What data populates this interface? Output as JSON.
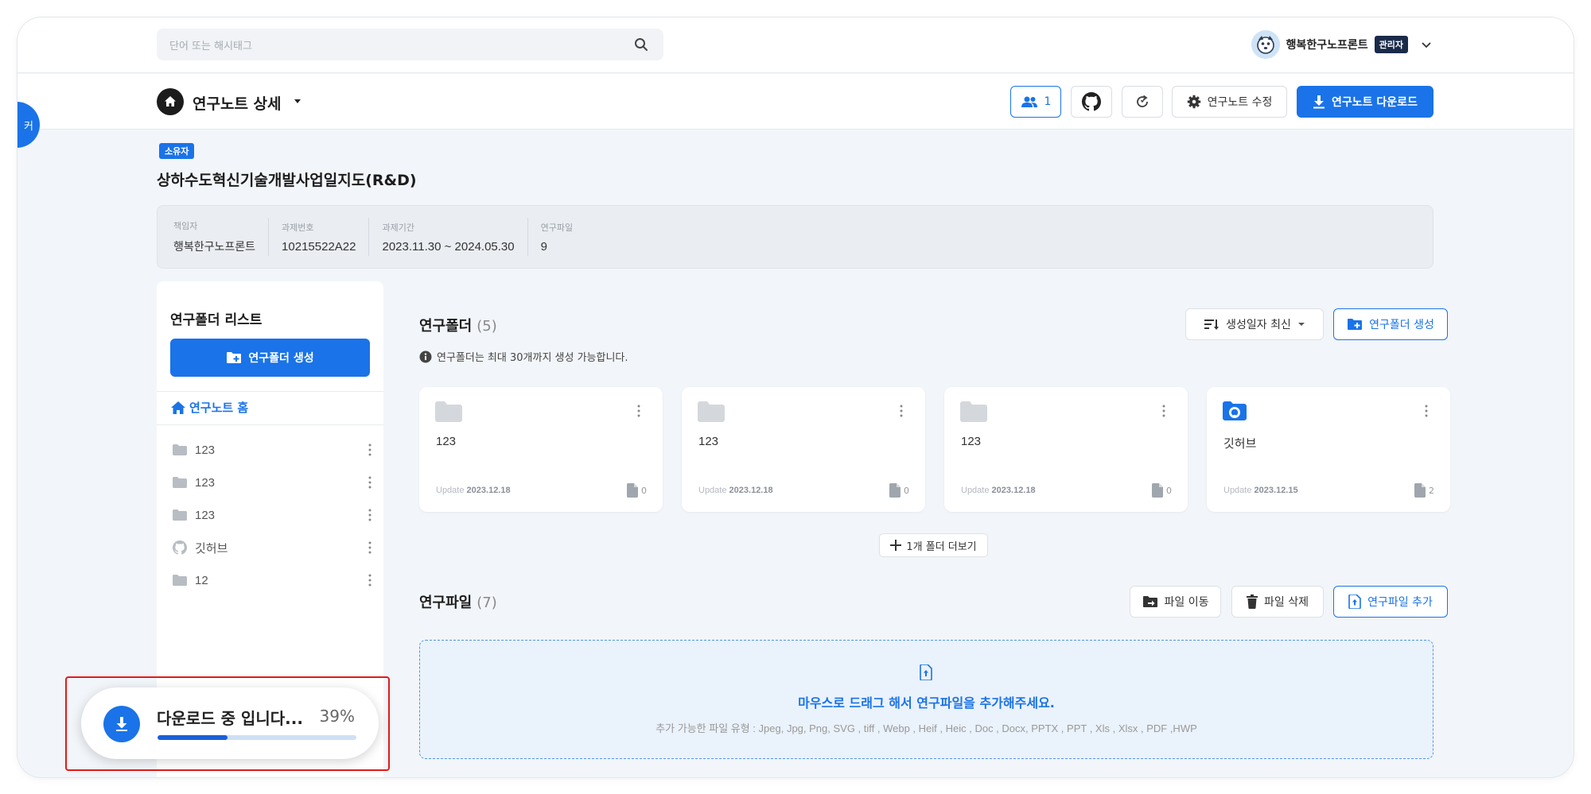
{
  "header": {
    "search_placeholder": "단어 또는 해시태그",
    "user_name": "행복한구노프론트",
    "user_role": "관리자"
  },
  "toolbar": {
    "page_title": "연구노트 상세",
    "member_count": "1",
    "edit_label": "연구노트 수정",
    "download_label": "연구노트 다운로드",
    "side_tab_label": "커"
  },
  "project": {
    "owner_badge": "소유자",
    "title": "상하수도혁신기술개발사업일지도(R&D)",
    "info": [
      {
        "label": "책임자",
        "value": "행복한구노프론트"
      },
      {
        "label": "과제번호",
        "value": "10215522A22"
      },
      {
        "label": "과제기간",
        "value": "2023.11.30 ~ 2024.05.30"
      },
      {
        "label": "연구파일",
        "value": "9"
      }
    ]
  },
  "sidebar": {
    "title": "연구폴더 리스트",
    "create_label": "연구폴더 생성",
    "home_label": "연구노트 홈",
    "items": [
      {
        "label": "123",
        "icon": "folder-icon"
      },
      {
        "label": "123",
        "icon": "folder-icon"
      },
      {
        "label": "123",
        "icon": "folder-icon"
      },
      {
        "label": "깃허브",
        "icon": "github-icon"
      },
      {
        "label": "12",
        "icon": "folder-icon"
      }
    ]
  },
  "folders": {
    "title": "연구폴더",
    "count": "(5)",
    "note": "연구폴더는 최대 30개까지 생성 가능합니다.",
    "sort_label": "생성일자 최신",
    "create_label": "연구폴더 생성",
    "cards": [
      {
        "name": "123",
        "update_prefix": "Update",
        "update_date": "2023.12.18",
        "files": "0",
        "icon": "folder-icon"
      },
      {
        "name": "123",
        "update_prefix": "Update",
        "update_date": "2023.12.18",
        "files": "0",
        "icon": "folder-icon"
      },
      {
        "name": "123",
        "update_prefix": "Update",
        "update_date": "2023.12.18",
        "files": "0",
        "icon": "folder-icon"
      },
      {
        "name": "깃허브",
        "update_prefix": "Update",
        "update_date": "2023.12.15",
        "files": "2",
        "icon": "github-folder-icon"
      }
    ],
    "more_label": "1개 폴더 더보기"
  },
  "files": {
    "title": "연구파일",
    "count": "(7)",
    "move_label": "파일 이동",
    "delete_label": "파일 삭제",
    "add_label": "연구파일 추가",
    "drop_main": "마우스로 드래그 해서 연구파일을 추가해주세요.",
    "drop_sub": "추가 가능한 파일 유형 : Jpeg, Jpg, Png, SVG , tiff , Webp , Heif , Heic , Doc , Docx, PPTX , PPT , Xls , Xlsx , PDF ,HWP"
  },
  "toast": {
    "message": "다운로드 중 입니다...",
    "percent_label": "39%",
    "progress": 0.35
  },
  "colors": {
    "accent": "#1a73e8",
    "background": "#f2f5f9",
    "highlight_outline": "#e11a1a"
  }
}
